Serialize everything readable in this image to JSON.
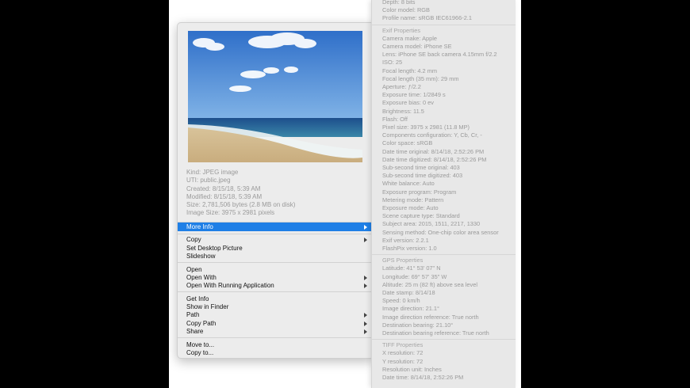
{
  "preview": {
    "info_lines": [
      "Kind: JPEG image",
      "UTI: public.jpeg",
      "Created: 8/15/18, 5:39 AM",
      "Modified: 8/15/18, 5:39 AM",
      "Size: 2,781,506 bytes (2.8 MB on disk)",
      "Image Size: 3975 x 2981 pixels"
    ]
  },
  "menu": {
    "more_info": "More Info",
    "copy": "Copy",
    "set_desktop": "Set Desktop Picture",
    "slideshow": "Slideshow",
    "open": "Open",
    "open_with": "Open With",
    "open_with_running": "Open With Running Application",
    "get_info": "Get Info",
    "show_in_finder": "Show in Finder",
    "path": "Path",
    "copy_path": "Copy Path",
    "share": "Share",
    "move_to": "Move to...",
    "copy_to": "Copy to...",
    "highlight_color": "#1f7fe6"
  },
  "panel": {
    "top": [
      "Depth: 8 bits",
      "Color model: RGB",
      "Profile name: sRGB IEC61966-2.1"
    ],
    "exif_title": "Exif Properties",
    "exif": [
      "Camera make: Apple",
      "Camera model: iPhone SE",
      "Lens: iPhone SE back camera 4.15mm f/2.2",
      "ISO: 25",
      "Focal length: 4.2 mm",
      "Focal length (35 mm): 29 mm",
      "Aperture: ƒ/2.2",
      "Exposure time: 1/2849 s",
      "Exposure bias: 0 ev",
      "Brightness: 11.5",
      "Flash: Off",
      "Pixel size: 3975 x 2981 (11.8 MP)",
      "Components configuration: Y, Cb, Cr, -",
      "Color space: sRGB",
      "Date time original: 8/14/18, 2:52:26 PM",
      "Date time digitized: 8/14/18, 2:52:26 PM",
      "Sub-second time original: 403",
      "Sub-second time digitized: 403",
      "White balance: Auto",
      "Exposure program: Program",
      "Metering mode: Pattern",
      "Exposure mode: Auto",
      "Scene capture type: Standard",
      "Subject area: 2015, 1511, 2217, 1330",
      "Sensing method: One-chip color area sensor",
      "Exif version: 2.2.1",
      "FlashPix version: 1.0"
    ],
    "gps_title": "GPS Properties",
    "gps": [
      "Latitude: 41° 53' 07\" N",
      "Longitude: 69° 57' 35\" W",
      "Altitude: 25 m (82 ft) above sea level",
      "Date stamp: 8/14/18",
      "Speed: 0 km/h",
      "Image direction: 21.1°",
      "Image direction reference: True north",
      "Destination bearing: 21.10°",
      "Destination bearing reference: True north"
    ],
    "tiff_title": "TIFF Properties",
    "tiff": [
      "X resolution: 72",
      "Y resolution: 72",
      "Resolution unit: Inches",
      "Date time: 8/14/18, 2:52:26 PM"
    ]
  }
}
